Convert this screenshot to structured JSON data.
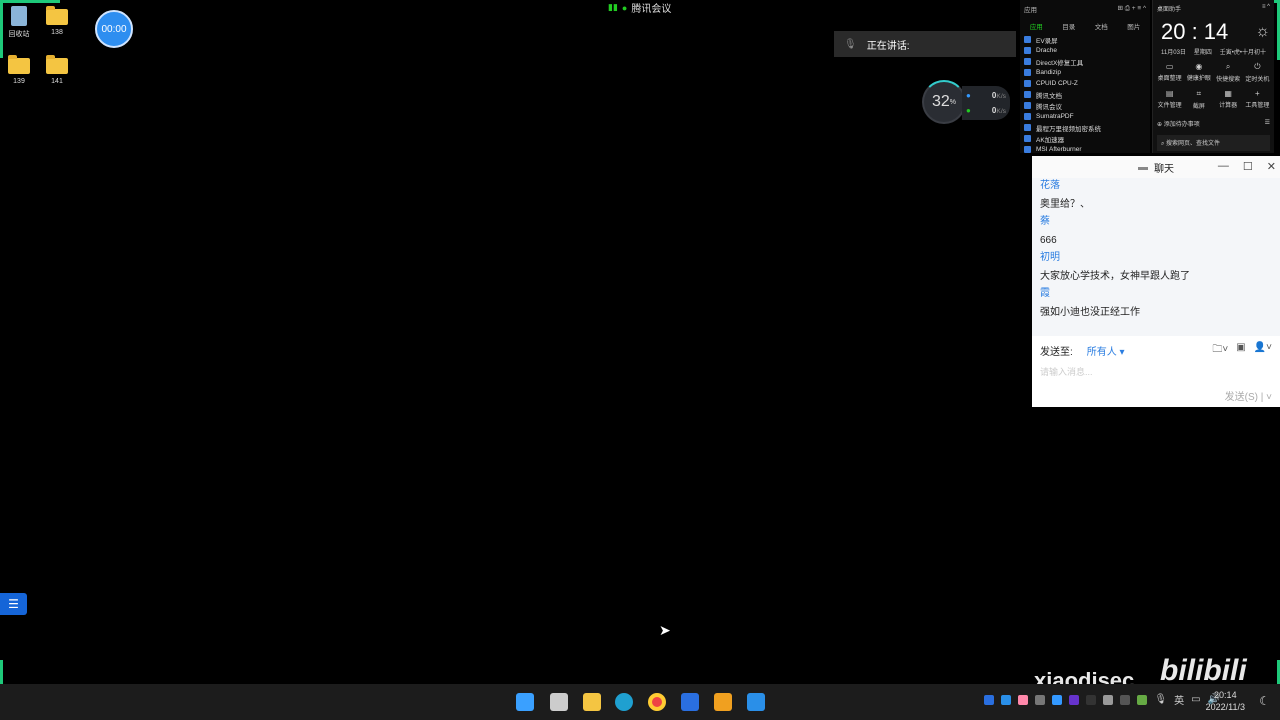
{
  "desktop": {
    "icons": [
      {
        "label": "回收站",
        "type": "recycle-bin"
      },
      {
        "label": "138",
        "type": "folder"
      },
      {
        "label": "139",
        "type": "folder"
      },
      {
        "label": "141",
        "type": "folder"
      }
    ],
    "timer": "00:00"
  },
  "meeting": {
    "title": "腾讯会议",
    "speaking_label": "正在讲话:"
  },
  "monitor": {
    "cpu_percent": "32",
    "cpu_unit": "%",
    "up": "0",
    "down": "0",
    "rate_unit": "K/s"
  },
  "apps_panel": {
    "title": "应用",
    "tabs": [
      "应用",
      "目录",
      "文档",
      "图片"
    ],
    "items": [
      "EV录屏",
      "Drache",
      "DirectX修复工具",
      "Bandizip",
      "CPUID CPU-Z",
      "腾讯文档",
      "腾讯会议",
      "SumatraPDF",
      "最程万里视频加密系统",
      "AK加速器",
      "MSI Afterburner"
    ]
  },
  "assistant": {
    "title": "桌面助手",
    "time": "20 : 14",
    "date": "11月03日",
    "weekday": "星期四",
    "lunar": "壬寅•虎•十月初十",
    "tools": [
      "桌面整理",
      "健康护眼",
      "快捷搜索",
      "定时关机",
      "文件管理",
      "截屏",
      "计算器",
      "工具管理"
    ],
    "todo": "添加待办事项",
    "search_placeholder": "搜索网页、查找文件"
  },
  "chat": {
    "title": "聊天",
    "messages": [
      {
        "name": "花落",
        "text": "奥里给？、"
      },
      {
        "name": "蔡",
        "text": "666"
      },
      {
        "name": "初明",
        "text": "大家放心学技术，女神早跟人跑了"
      },
      {
        "name": "霞",
        "text": "强如小迪也没正经工作"
      }
    ],
    "send_to_label": "发送至:",
    "recipient": "所有人",
    "input_placeholder": "请输入消息...",
    "send_button": "发送(S)"
  },
  "taskbar": {
    "time": "20:14",
    "date": "2022/11/3",
    "ime": "英"
  },
  "watermark": {
    "text": "xiaodisec",
    "logo": "bilibili"
  }
}
